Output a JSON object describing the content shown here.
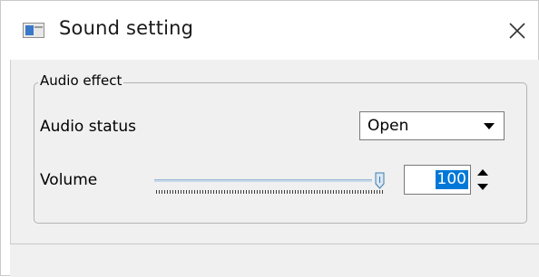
{
  "window": {
    "title": "Sound setting",
    "icons": {
      "app": "window-app-icon",
      "close": "close-icon"
    }
  },
  "audio_effect": {
    "group_title": "Audio effect",
    "audio_status_label": "Audio status",
    "audio_status_value": "Open",
    "volume_label": "Volume",
    "volume_value": "100",
    "volume_level": 100,
    "volume_max": 100
  },
  "colors": {
    "selection": "#0078d7",
    "background": "#f0f0f0",
    "app_icon_blue": "#3a78c8"
  },
  "statusbar": {
    "text": ""
  }
}
